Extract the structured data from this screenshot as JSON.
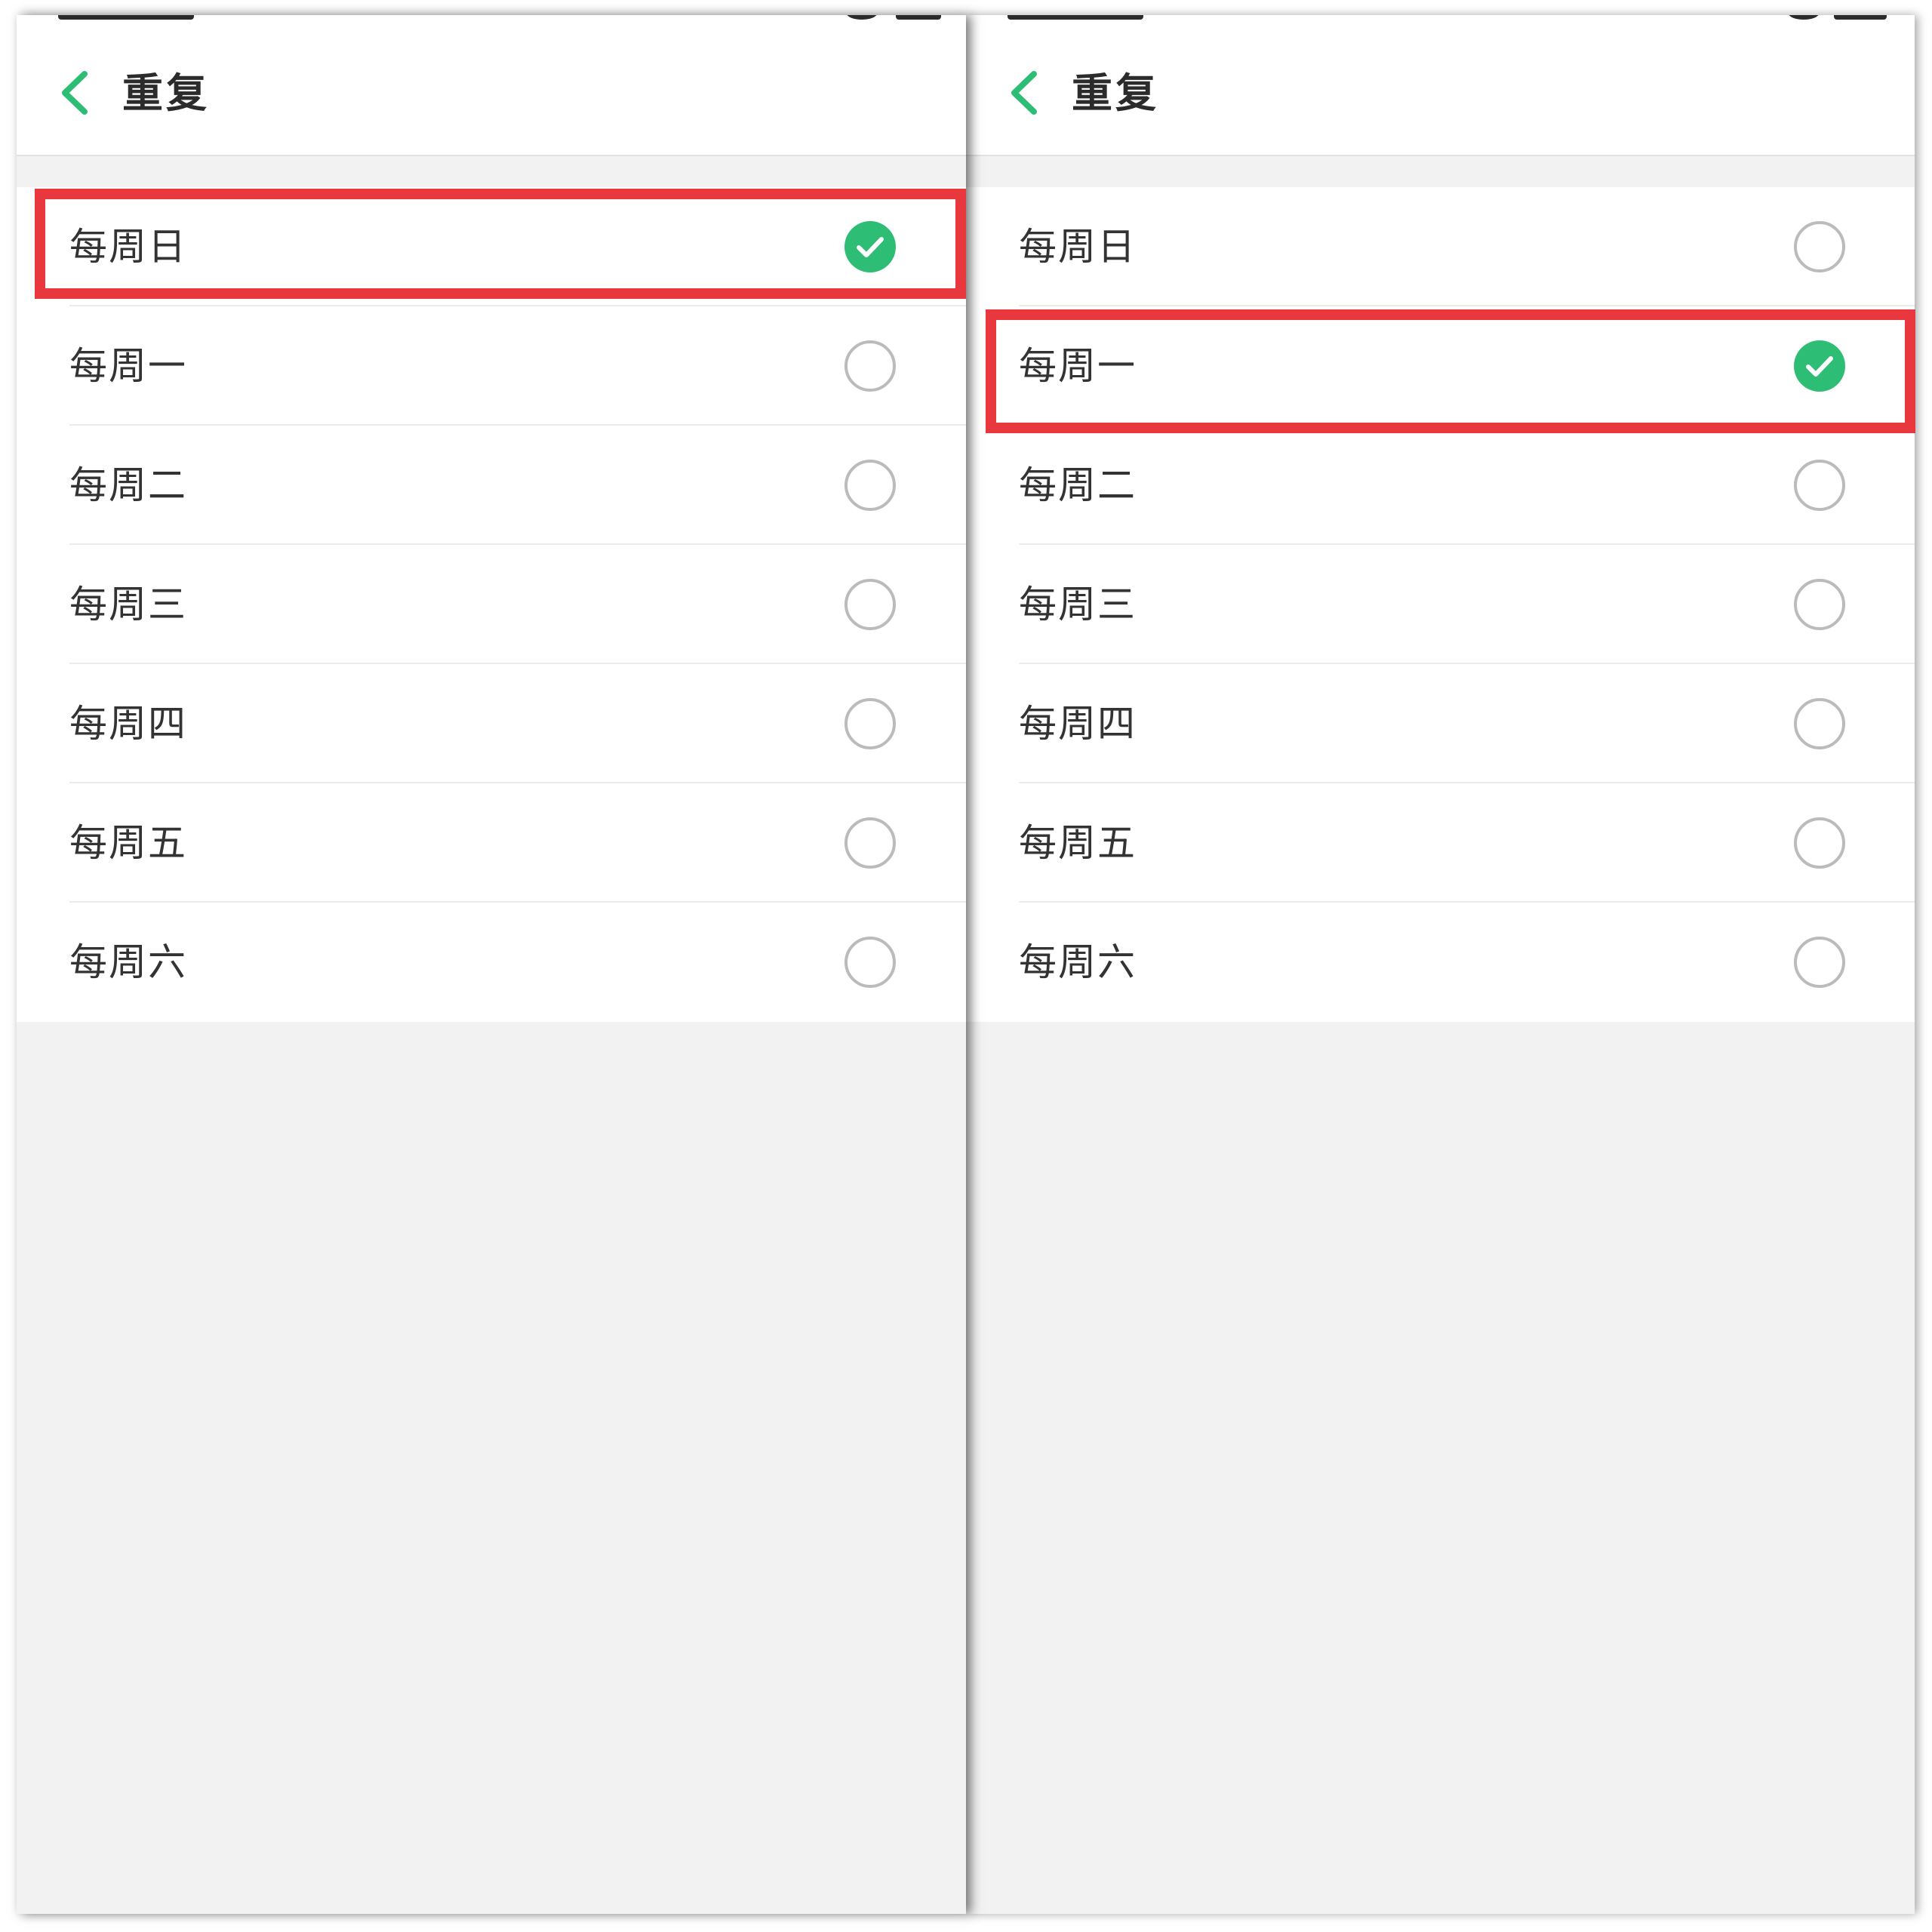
{
  "panels": [
    {
      "title": "重复",
      "options": [
        {
          "label": "每周日",
          "selected": true
        },
        {
          "label": "每周一",
          "selected": false
        },
        {
          "label": "每周二",
          "selected": false
        },
        {
          "label": "每周三",
          "selected": false
        },
        {
          "label": "每周四",
          "selected": false
        },
        {
          "label": "每周五",
          "selected": false
        },
        {
          "label": "每周六",
          "selected": false
        }
      ],
      "highlighted_option": "每周日"
    },
    {
      "title": "重复",
      "options": [
        {
          "label": "每周日",
          "selected": false
        },
        {
          "label": "每周一",
          "selected": true
        },
        {
          "label": "每周二",
          "selected": false
        },
        {
          "label": "每周三",
          "selected": false
        },
        {
          "label": "每周四",
          "selected": false
        },
        {
          "label": "每周五",
          "selected": false
        },
        {
          "label": "每周六",
          "selected": false
        }
      ],
      "highlighted_option": "每周一"
    }
  ],
  "colors": {
    "accent": "#2dbd75",
    "highlight": "#e8383e",
    "unchecked_ring": "#bbbbbb",
    "background": "#f2f2f2"
  },
  "icons": {
    "back": "chevron-left-icon",
    "checked": "check-circle-icon",
    "unchecked": "empty-circle-icon"
  }
}
